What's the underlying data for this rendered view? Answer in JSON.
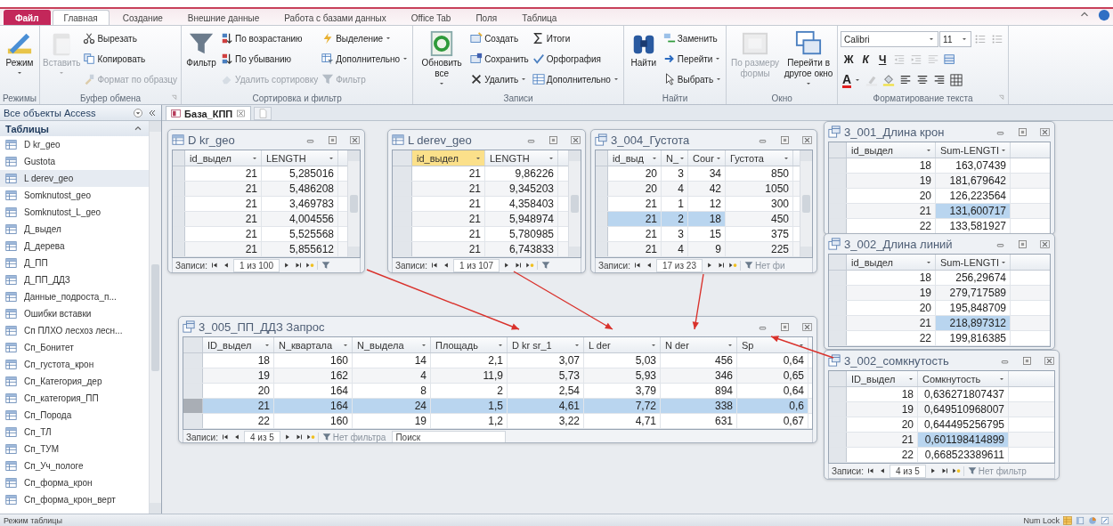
{
  "ribbon": {
    "tabs": [
      {
        "label": "Файл",
        "kind": "file",
        "selected": false
      },
      {
        "label": "Главная",
        "kind": "tab",
        "selected": true
      },
      {
        "label": "Создание",
        "kind": "tab",
        "selected": false
      },
      {
        "label": "Внешние данные",
        "kind": "tab",
        "selected": false
      },
      {
        "label": "Работа с базами данных",
        "kind": "tab",
        "selected": false
      },
      {
        "label": "Office Tab",
        "kind": "tab",
        "selected": false
      },
      {
        "label": "Поля",
        "kind": "tab",
        "selected": false
      },
      {
        "label": "Таблица",
        "kind": "tab",
        "selected": false
      }
    ],
    "groups": [
      {
        "label": "Режимы",
        "launcher": false,
        "columns": [
          [
            {
              "kind": "large",
              "label": "Режим",
              "dropdown": true,
              "disabled": false
            }
          ]
        ]
      },
      {
        "label": "Буфер обмена",
        "launcher": true,
        "columns": [
          [
            {
              "kind": "large",
              "label": "Вставить",
              "dropdown": true,
              "disabled": true
            }
          ],
          [
            {
              "kind": "small",
              "label": "Вырезать",
              "dropdown": false,
              "disabled": false
            },
            {
              "kind": "small",
              "label": "Копировать",
              "dropdown": false,
              "disabled": false
            },
            {
              "kind": "small",
              "label": "Формат по образцу",
              "dropdown": false,
              "disabled": true
            }
          ]
        ]
      },
      {
        "label": "Сортировка и фильтр",
        "launcher": false,
        "columns": [
          [
            {
              "kind": "large",
              "label": "Фильтр",
              "dropdown": false,
              "disabled": false
            }
          ],
          [
            {
              "kind": "small",
              "label": "По возрастанию",
              "dropdown": false,
              "disabled": false
            },
            {
              "kind": "small",
              "label": "По убыванию",
              "dropdown": false,
              "disabled": false
            },
            {
              "kind": "small",
              "label": "Удалить сортировку",
              "dropdown": false,
              "disabled": true
            }
          ],
          [
            {
              "kind": "small",
              "label": "Выделение",
              "dropdown": true,
              "disabled": false
            },
            {
              "kind": "small",
              "label": "Дополнительно",
              "dropdown": true,
              "disabled": false
            },
            {
              "kind": "small",
              "label": "Фильтр",
              "dropdown": false,
              "disabled": true
            }
          ]
        ]
      },
      {
        "label": "Записи",
        "launcher": false,
        "columns": [
          [
            {
              "kind": "large",
              "label": "Обновить все",
              "dropdown": true,
              "disabled": false
            }
          ],
          [
            {
              "kind": "small",
              "label": "Создать",
              "dropdown": false,
              "disabled": false
            },
            {
              "kind": "small",
              "label": "Сохранить",
              "dropdown": false,
              "disabled": false
            },
            {
              "kind": "small",
              "label": "Удалить",
              "dropdown": true,
              "disabled": false
            }
          ],
          [
            {
              "kind": "small",
              "label": "Итоги",
              "dropdown": false,
              "disabled": false
            },
            {
              "kind": "small",
              "label": "Орфография",
              "dropdown": false,
              "disabled": false
            },
            {
              "kind": "small",
              "label": "Дополнительно",
              "dropdown": true,
              "disabled": false
            }
          ]
        ]
      },
      {
        "label": "Найти",
        "launcher": false,
        "columns": [
          [
            {
              "kind": "large",
              "label": "Найти",
              "dropdown": false,
              "disabled": false
            }
          ],
          [
            {
              "kind": "small",
              "label": "Заменить",
              "dropdown": false,
              "disabled": false
            },
            {
              "kind": "small",
              "label": "Перейти",
              "dropdown": true,
              "disabled": false
            },
            {
              "kind": "small",
              "label": "Выбрать",
              "dropdown": true,
              "disabled": false
            }
          ]
        ]
      },
      {
        "label": "Окно",
        "launcher": false,
        "columns": [
          [
            {
              "kind": "large",
              "label": "По размеру формы",
              "dropdown": false,
              "disabled": true
            }
          ],
          [
            {
              "kind": "large",
              "label": "Перейти в другое окно",
              "dropdown": true,
              "disabled": false
            }
          ]
        ]
      },
      {
        "label": "Форматирование текста",
        "launcher": true,
        "rows": [
          [
            {
              "kind": "combo",
              "value": "Calibri",
              "disabled": false
            },
            {
              "kind": "combo",
              "value": "11",
              "disabled": false
            },
            {
              "kind": "icon",
              "disabled": true
            },
            {
              "kind": "icon",
              "disabled": true
            }
          ],
          [
            {
              "kind": "glyph",
              "label": "Ж",
              "disabled": false
            },
            {
              "kind": "glyph",
              "label": "К",
              "disabled": false
            },
            {
              "kind": "glyph",
              "label": "Ч",
              "disabled": false
            },
            {
              "kind": "icon",
              "disabled": true
            },
            {
              "kind": "icon",
              "disabled": true
            },
            {
              "kind": "icon",
              "disabled": true
            },
            {
              "kind": "icon",
              "disabled": false
            }
          ],
          [
            {
              "kind": "fontcolor",
              "label": "A",
              "disabled": false
            },
            {
              "kind": "icon",
              "disabled": true
            },
            {
              "kind": "icon",
              "disabled": false
            },
            {
              "kind": "icon",
              "disabled": false
            },
            {
              "kind": "icon",
              "disabled": false
            },
            {
              "kind": "icon",
              "disabled": false
            },
            {
              "kind": "icon",
              "disabled": false
            }
          ]
        ]
      }
    ]
  },
  "nav_pane": {
    "title": "Все объекты Access",
    "section": "Таблицы",
    "items": [
      {
        "label": "D kr_geo",
        "selected": false
      },
      {
        "label": "Gustota",
        "selected": false
      },
      {
        "label": "L derev_geo",
        "selected": true
      },
      {
        "label": "Somknutost_geo",
        "selected": false
      },
      {
        "label": "Somknutost_L_geo",
        "selected": false
      },
      {
        "label": "Д_выдел",
        "selected": false
      },
      {
        "label": "Д_дерева",
        "selected": false
      },
      {
        "label": "Д_ПП",
        "selected": false
      },
      {
        "label": "Д_ПП_ДДЗ",
        "selected": false
      },
      {
        "label": "Данные_подроста_п...",
        "selected": false
      },
      {
        "label": "Ошибки вставки",
        "selected": false
      },
      {
        "label": "Сп ПЛХО лесхоз лесн...",
        "selected": false
      },
      {
        "label": "Сп_Бонитет",
        "selected": false
      },
      {
        "label": "Сп_густота_крон",
        "selected": false
      },
      {
        "label": "Сп_Категория_дер",
        "selected": false
      },
      {
        "label": "Сп_категория_ПП",
        "selected": false
      },
      {
        "label": "Сп_Порода",
        "selected": false
      },
      {
        "label": "Сп_ТЛ",
        "selected": false
      },
      {
        "label": "Сп_ТУМ",
        "selected": false
      },
      {
        "label": "Сп_Уч_пологе",
        "selected": false
      },
      {
        "label": "Сп_форма_крон",
        "selected": false
      },
      {
        "label": "Сп_форма_крон_верт",
        "selected": false
      }
    ]
  },
  "doc_tabs": [
    {
      "label": "База_КПП",
      "selected": true
    }
  ],
  "windows": [
    {
      "kind": "table",
      "title": "D kr_geo",
      "scrollbar": true,
      "columns": [
        {
          "label": "id_выдел",
          "active": false
        },
        {
          "label": "LENGTH",
          "active": false
        }
      ],
      "rows": [
        {
          "cells": [
            "21",
            "5,285016"
          ]
        },
        {
          "cells": [
            "21",
            "5,486208"
          ]
        },
        {
          "cells": [
            "21",
            "3,469783"
          ]
        },
        {
          "cells": [
            "21",
            "4,004556"
          ]
        },
        {
          "cells": [
            "21",
            "5,525568"
          ]
        },
        {
          "cells": [
            "21",
            "5,855612"
          ]
        }
      ],
      "nav": {
        "label": "Записи:",
        "position": "1 из 100"
      }
    },
    {
      "kind": "table",
      "title": "L derev_geo",
      "scrollbar": true,
      "columns": [
        {
          "label": "id_выдел",
          "active": true
        },
        {
          "label": "LENGTH",
          "active": false
        }
      ],
      "rows": [
        {
          "cells": [
            "21",
            "9,86226"
          ]
        },
        {
          "cells": [
            "21",
            "9,345203"
          ]
        },
        {
          "cells": [
            "21",
            "4,358403"
          ]
        },
        {
          "cells": [
            "21",
            "5,948974"
          ]
        },
        {
          "cells": [
            "21",
            "5,780985"
          ]
        },
        {
          "cells": [
            "21",
            "6,743833"
          ]
        }
      ],
      "nav": {
        "label": "Записи:",
        "position": "1 из 107"
      }
    },
    {
      "kind": "query",
      "title": "3_004_Густота",
      "scrollbar": true,
      "columns": [
        {
          "label": "id_выд",
          "active": false,
          "in_selection": true
        },
        {
          "label": "N_",
          "active": false,
          "in_selection": true
        },
        {
          "label": "Cour",
          "active": false,
          "in_selection": true
        },
        {
          "label": "Густота",
          "active": false,
          "in_selection": false
        }
      ],
      "rows": [
        {
          "cells": [
            "20",
            "3",
            "34",
            "850"
          ],
          "selected": false
        },
        {
          "cells": [
            "20",
            "4",
            "42",
            "1050"
          ],
          "selected": false
        },
        {
          "cells": [
            "21",
            "1",
            "12",
            "300"
          ],
          "selected": false
        },
        {
          "cells": [
            "21",
            "2",
            "18",
            "450"
          ],
          "selected": true
        },
        {
          "cells": [
            "21",
            "3",
            "15",
            "375"
          ],
          "selected": false
        },
        {
          "cells": [
            "21",
            "4",
            "9",
            "225"
          ],
          "selected": false
        }
      ],
      "nav": {
        "label": "Записи:",
        "position": "17 из 23",
        "filter": "Нет фи"
      }
    },
    {
      "kind": "query",
      "title": "3_005_ПП_ДДЗ Запрос",
      "columns": [
        {
          "label": "ID_выдел",
          "active": false,
          "in_selection": true
        },
        {
          "label": "N_квартала",
          "active": false,
          "in_selection": true
        },
        {
          "label": "N_выдела",
          "active": false,
          "in_selection": true
        },
        {
          "label": "Площадь",
          "active": false,
          "in_selection": true
        },
        {
          "label": "D kr sr_1",
          "active": false,
          "in_selection": true
        },
        {
          "label": "L der",
          "active": false,
          "in_selection": true
        },
        {
          "label": "N der",
          "active": false,
          "in_selection": true
        },
        {
          "label": "Sp",
          "active": false,
          "in_selection": true
        }
      ],
      "rows": [
        {
          "cells": [
            "18",
            "160",
            "14",
            "2,1",
            "3,07",
            "5,03",
            "456",
            "0,64"
          ],
          "selected": false
        },
        {
          "cells": [
            "19",
            "162",
            "4",
            "11,9",
            "5,73",
            "5,93",
            "346",
            "0,65"
          ],
          "selected": false
        },
        {
          "cells": [
            "20",
            "164",
            "8",
            "2",
            "2,54",
            "3,79",
            "894",
            "0,64"
          ],
          "selected": false
        },
        {
          "cells": [
            "21",
            "164",
            "24",
            "1,5",
            "4,61",
            "7,72",
            "338",
            "0,6"
          ],
          "selected": true
        },
        {
          "cells": [
            "22",
            "160",
            "19",
            "1,2",
            "3,22",
            "4,71",
            "631",
            "0,67"
          ],
          "selected": false
        }
      ],
      "nav": {
        "label": "Записи:",
        "position": "4 из 5",
        "filter": "Нет фильтра",
        "search": {
          "placeholder": "Поиск"
        }
      }
    },
    {
      "kind": "query",
      "title": "3_001_Длина крон",
      "columns": [
        {
          "label": "id_выдел",
          "active": false,
          "in_selection": false
        },
        {
          "label": "Sum-LENGTI",
          "active": false,
          "in_selection": true
        }
      ],
      "rows": [
        {
          "cells": [
            "18",
            "163,07439"
          ],
          "selected": false
        },
        {
          "cells": [
            "19",
            "181,679642"
          ],
          "selected": false
        },
        {
          "cells": [
            "20",
            "126,223564"
          ],
          "selected": false
        },
        {
          "cells": [
            "21",
            "131,600717"
          ],
          "selected": true
        },
        {
          "cells": [
            "22",
            "133,581927"
          ],
          "selected": false
        }
      ]
    },
    {
      "kind": "query",
      "title": "3_002_Длина линий",
      "columns": [
        {
          "label": "id_выдел",
          "active": false,
          "in_selection": false
        },
        {
          "label": "Sum-LENGTI",
          "active": false,
          "in_selection": true
        }
      ],
      "rows": [
        {
          "cells": [
            "18",
            "256,29674"
          ],
          "selected": false
        },
        {
          "cells": [
            "19",
            "279,717589"
          ],
          "selected": false
        },
        {
          "cells": [
            "20",
            "195,848709"
          ],
          "selected": false
        },
        {
          "cells": [
            "21",
            "218,897312"
          ],
          "selected": true
        },
        {
          "cells": [
            "22",
            "199,816385"
          ],
          "selected": false
        }
      ]
    },
    {
      "kind": "query",
      "title": "3_002_сомкнутость",
      "columns": [
        {
          "label": "ID_выдел",
          "active": false,
          "in_selection": false
        },
        {
          "label": "Сомкнутость",
          "active": false,
          "in_selection": true
        }
      ],
      "rows": [
        {
          "cells": [
            "18",
            "0,636271807437"
          ],
          "selected": false
        },
        {
          "cells": [
            "19",
            "0,649510968007"
          ],
          "selected": false
        },
        {
          "cells": [
            "20",
            "0,644495256795"
          ],
          "selected": false
        },
        {
          "cells": [
            "21",
            "0,601198414899"
          ],
          "selected": true
        },
        {
          "cells": [
            "22",
            "0,668523389611"
          ],
          "selected": false
        }
      ],
      "nav": {
        "label": "Записи:",
        "position": "4 из 5",
        "filter": "Нет фильтр"
      }
    }
  ],
  "status_bar": {
    "mode": "Режим таблицы",
    "indicator": "Num Lock"
  }
}
